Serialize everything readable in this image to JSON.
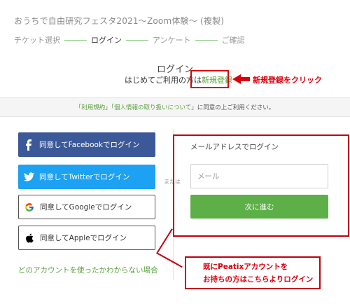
{
  "header": {
    "event_title": "おうちで自由研究フェスタ2021～Zoom体験～ (複製)",
    "steps": [
      {
        "label": "チケット選択"
      },
      {
        "label": "ログイン"
      },
      {
        "label": "アンケート"
      },
      {
        "label": "ご確認"
      }
    ],
    "active_step": "ログイン"
  },
  "login": {
    "heading": "ログイン",
    "first_time_text": "はじめてご利用の方は",
    "signup_link": "新規登録"
  },
  "annotations": {
    "signup_note": "新規登録をクリック",
    "existing_account_line1": "既にPeatixアカウントを",
    "existing_account_line2": "お持ちの方はこちらよりログイン"
  },
  "consent": {
    "terms": "「利用規約」",
    "privacy": "「個人情報の取り扱いについて」",
    "suffix": "に同意の上ご利用ください。"
  },
  "social": {
    "facebook": "同意してFacebookでログイン",
    "twitter": "同意してTwitterでログイン",
    "google": "同意してGoogleでログイン",
    "apple": "同意してAppleでログイン"
  },
  "or_text": "または",
  "help_link": "どのアカウントを使ったかわからない場合",
  "email_login": {
    "heading": "メールアドレスでログイン",
    "email_placeholder": "メール",
    "next_button": "次に進む"
  },
  "colors": {
    "accent_green": "#5cb047",
    "facebook_blue": "#3b5998",
    "twitter_blue": "#1da1f2",
    "annotation_red": "#d8000c"
  }
}
